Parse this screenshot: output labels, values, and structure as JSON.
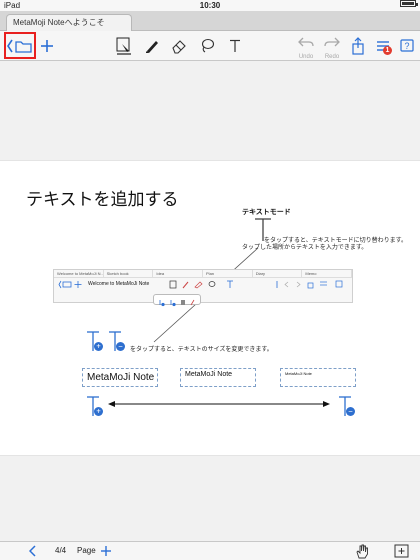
{
  "status_bar": {
    "device": "iPad",
    "time": "10:30"
  },
  "tab": {
    "title": "MetaMoji Noteへようこそ"
  },
  "toolbar": {
    "undo_label": "Undo",
    "redo_label": "Redo",
    "notification_badge": "1",
    "accent_color": "#2b6fd6",
    "highlight_color": "#e8201f"
  },
  "slide": {
    "title": "テキストを追加する",
    "mode_title": "テキストモード",
    "mode_desc_1": "をタップすると、テキストモードに切り替わります。",
    "mode_desc_2": "タップした場所からテキストを入力できます。",
    "size_desc": "をタップすると、テキストのサイズを変更できます。",
    "sample_text_large": "MetaMoJi Note",
    "sample_text_medium": "MetaMoJi Note",
    "sample_text_small": "MetaMoJi Note"
  },
  "mini_screenshot": {
    "tabs": [
      "Welcome to MetaMoJi N...",
      "Sketch book",
      "Idea",
      "Plan",
      "Diary",
      "Memo"
    ],
    "doc_title": "Welcome to MetaMoJi Note"
  },
  "bottom_bar": {
    "page_indicator": "4/4",
    "page_label": "Page"
  }
}
